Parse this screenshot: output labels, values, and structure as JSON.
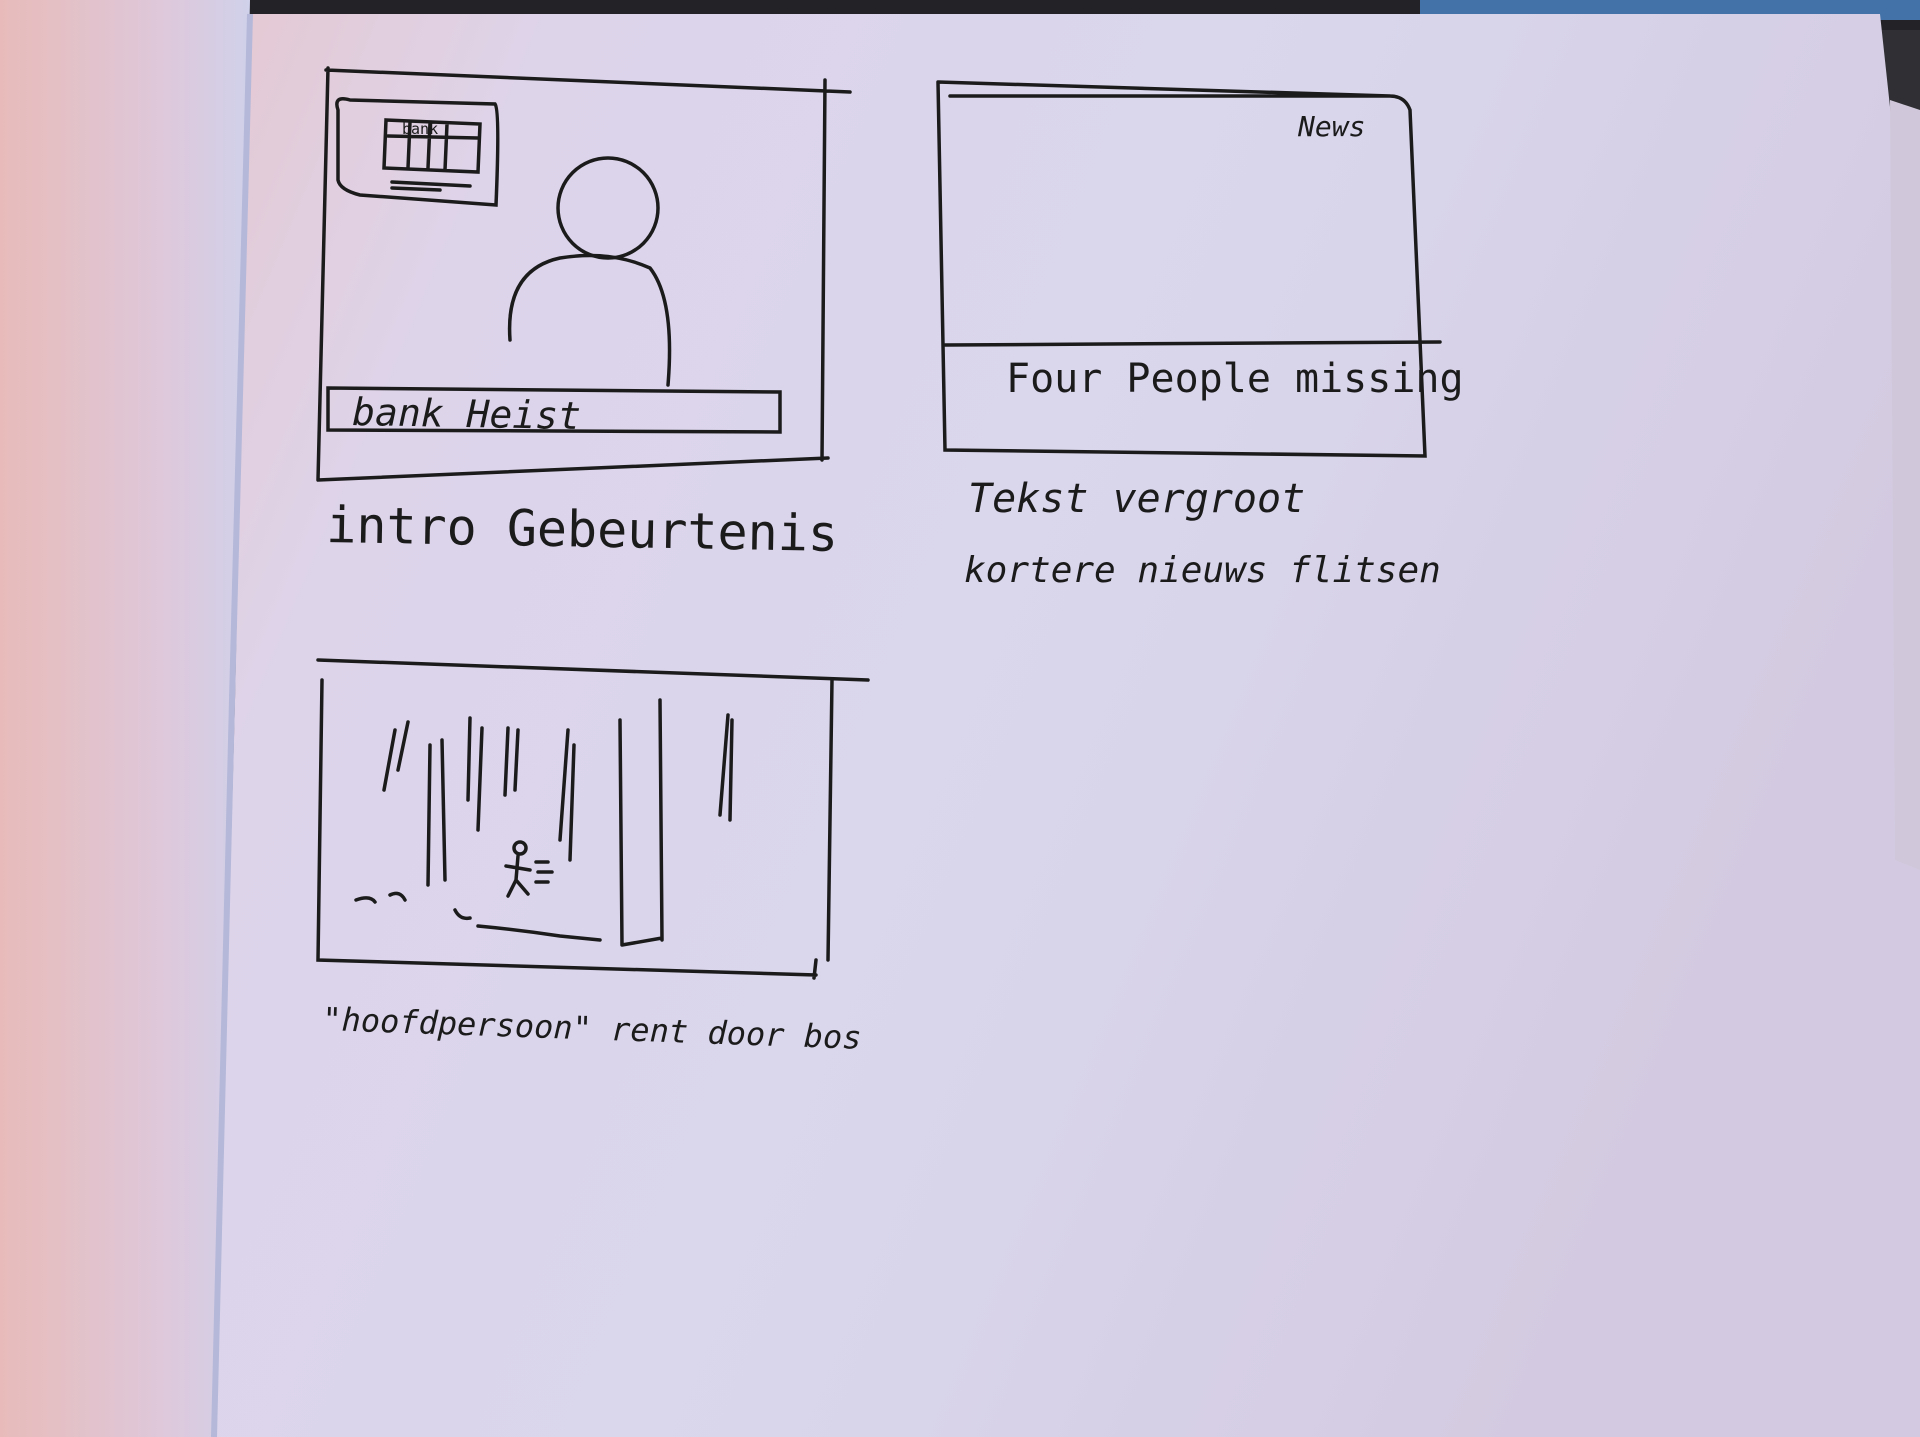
{
  "storyboard": {
    "panel_1": {
      "lower_third_text": "bank Heist",
      "inset_label": "bank",
      "caption": "intro Gebeurtenis"
    },
    "panel_2": {
      "corner_label": "News",
      "ticker_text": "Four People missing",
      "caption_line_1": "Tekst vergroot",
      "caption_line_2": "kortere nieuws flitsen"
    },
    "panel_3": {
      "caption": "\"hoofdpersoon\" rent door bos"
    }
  },
  "colors": {
    "paper": "#d9d2ea",
    "ink": "#141414",
    "background": "#2a2a2e"
  }
}
